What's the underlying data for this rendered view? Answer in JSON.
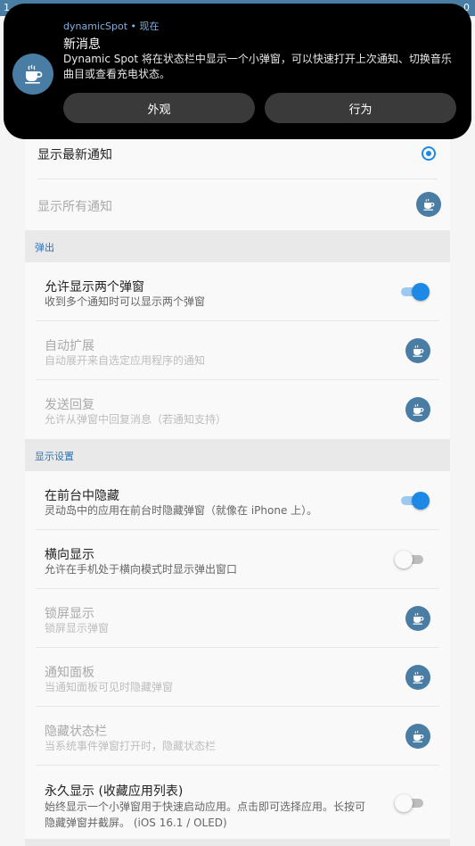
{
  "status_bar": {
    "time": "1",
    "battery_glyph": "0"
  },
  "notification": {
    "header": "dynamicSpot • 现在",
    "title": "新消息",
    "body": "Dynamic Spot 将在状态栏中显示一个小弹窗，可以快速打开上次通知、切换音乐曲目或查看充电状态。",
    "buttons": [
      "外观",
      "行为"
    ],
    "icon": "coffee-cup-icon"
  },
  "notify_group": {
    "show_latest": "显示最新通知",
    "show_all": "显示所有通知"
  },
  "popup_section": {
    "title": "弹出",
    "items": [
      {
        "title": "允许显示两个弹窗",
        "subtitle": "收到多个通知时可以显示两个弹窗",
        "control": "switch",
        "on": true,
        "enabled": true
      },
      {
        "title": "自动扩展",
        "subtitle": "自动展开来自选定应用程序的通知",
        "control": "pro",
        "enabled": false
      },
      {
        "title": "发送回复",
        "subtitle": "允许从弹窗中回复消息（若通知支持）",
        "control": "pro",
        "enabled": false
      }
    ]
  },
  "display_section": {
    "title": "显示设置",
    "items": [
      {
        "title": "在前台中隐藏",
        "subtitle": "灵动岛中的应用在前台时隐藏弹窗（就像在 iPhone 上）。",
        "control": "switch",
        "on": true,
        "enabled": true
      },
      {
        "title": "横向显示",
        "subtitle": "允许在手机处于横向模式时显示弹出窗口",
        "control": "switch",
        "on": false,
        "enabled": true
      },
      {
        "title": "锁屏显示",
        "subtitle": "锁屏显示弹窗",
        "control": "pro",
        "enabled": false
      },
      {
        "title": "通知面板",
        "subtitle": "当通知面板可见时隐藏弹窗",
        "control": "pro",
        "enabled": false
      },
      {
        "title": "隐藏状态栏",
        "subtitle": "当系统事件弹窗打开时，隐藏状态栏",
        "control": "pro",
        "enabled": false
      },
      {
        "title": "永久显示 (收藏应用列表)",
        "subtitle_lines": [
          "始终显示一个小弹窗用于快速启动应用。点击即可选择应用。长按可",
          "隐藏弹窗并截屏。 (iOS 16.1 / OLED)"
        ],
        "control": "switch",
        "on": false,
        "enabled": true
      }
    ]
  },
  "colors": {
    "accent": "#1e88e5",
    "section_text": "#2b72b8",
    "icon_bg": "#4a7da3"
  }
}
